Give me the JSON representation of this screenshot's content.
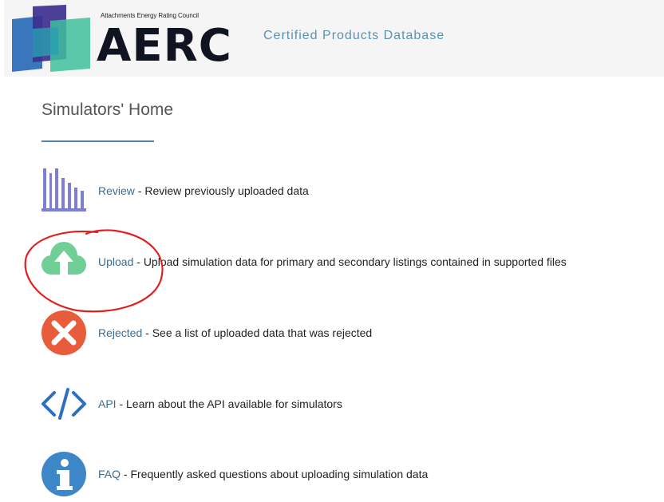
{
  "header": {
    "org_name": "Attachments Energy Rating Council",
    "logo_text": "AERC",
    "db_title": "Certified Products Database",
    "colors": {
      "background": "#f5f5f5",
      "title": "#5b92b0"
    }
  },
  "page": {
    "title": "Simulators' Home"
  },
  "items": [
    {
      "icon": "bar-chart-icon",
      "link": "Review",
      "desc": " - Review previously uploaded data"
    },
    {
      "icon": "cloud-upload-icon",
      "link": "Upload",
      "desc": " - Upload simulation data for primary and secondary listings contained in supported files"
    },
    {
      "icon": "reject-x-icon",
      "link": "Rejected",
      "desc": " - See a list of uploaded data that was rejected"
    },
    {
      "icon": "code-icon",
      "link": "API",
      "desc": " - Learn about the API available for simulators"
    },
    {
      "icon": "info-icon",
      "link": "FAQ",
      "desc": " - Frequently asked questions about uploading simulation data"
    }
  ],
  "colors": {
    "link": "#3c6c93",
    "rule": "#5282a8",
    "annotation": "#e02020"
  }
}
